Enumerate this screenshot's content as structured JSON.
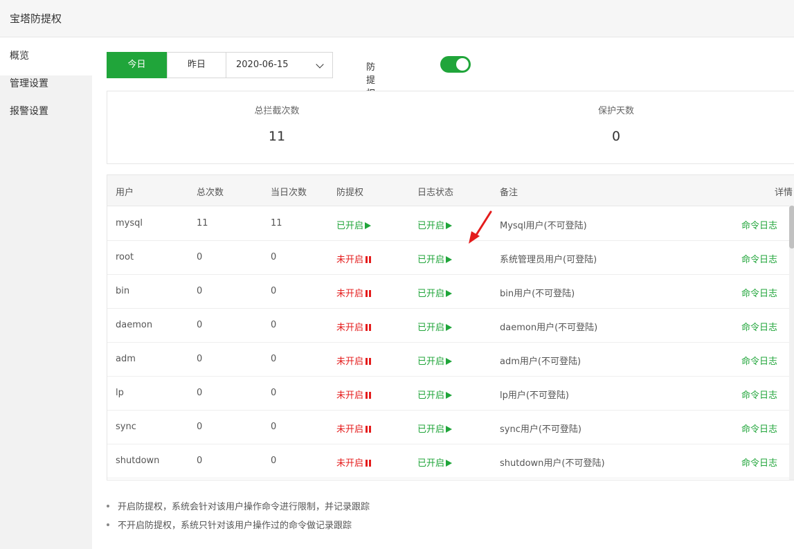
{
  "app": {
    "title": "宝塔防提权"
  },
  "sidebar": {
    "items": [
      {
        "label": "概览"
      },
      {
        "label": "管理设置"
      },
      {
        "label": "报警设置"
      }
    ]
  },
  "toolbar": {
    "today_label": "今日",
    "yesterday_label": "昨日",
    "date_value": "2020-06-15",
    "switch_label": "防提权开关",
    "switch_on": true
  },
  "stats": {
    "total_label": "总拦截次数",
    "total_value": "11",
    "days_label": "保护天数",
    "days_value": "0"
  },
  "table": {
    "headers": {
      "user": "用户",
      "total": "总次数",
      "day": "当日次数",
      "anti": "防提权",
      "log": "日志状态",
      "note": "备注",
      "detail": "详情"
    },
    "on_text": "已开启",
    "off_text": "未开启",
    "detail_text": "命令日志",
    "rows": [
      {
        "user": "mysql",
        "total": "11",
        "day": "11",
        "anti_on": true,
        "log_on": true,
        "note": "Mysql用户(不可登陆)"
      },
      {
        "user": "root",
        "total": "0",
        "day": "0",
        "anti_on": false,
        "log_on": true,
        "note": "系统管理员用户(可登陆)"
      },
      {
        "user": "bin",
        "total": "0",
        "day": "0",
        "anti_on": false,
        "log_on": true,
        "note": "bin用户(不可登陆)"
      },
      {
        "user": "daemon",
        "total": "0",
        "day": "0",
        "anti_on": false,
        "log_on": true,
        "note": "daemon用户(不可登陆)"
      },
      {
        "user": "adm",
        "total": "0",
        "day": "0",
        "anti_on": false,
        "log_on": true,
        "note": "adm用户(不可登陆)"
      },
      {
        "user": "lp",
        "total": "0",
        "day": "0",
        "anti_on": false,
        "log_on": true,
        "note": "lp用户(不可登陆)"
      },
      {
        "user": "sync",
        "total": "0",
        "day": "0",
        "anti_on": false,
        "log_on": true,
        "note": "sync用户(不可登陆)"
      },
      {
        "user": "shutdown",
        "total": "0",
        "day": "0",
        "anti_on": false,
        "log_on": true,
        "note": "shutdown用户(不可登陆)"
      }
    ]
  },
  "notes": [
    "开启防提权，系统会针对该用户操作命令进行限制，并记录跟踪",
    "不开启防提权，系统只针对该用户操作过的命令做记录跟踪"
  ],
  "colors": {
    "accent": "#20a53a",
    "danger": "#e41c1c"
  }
}
